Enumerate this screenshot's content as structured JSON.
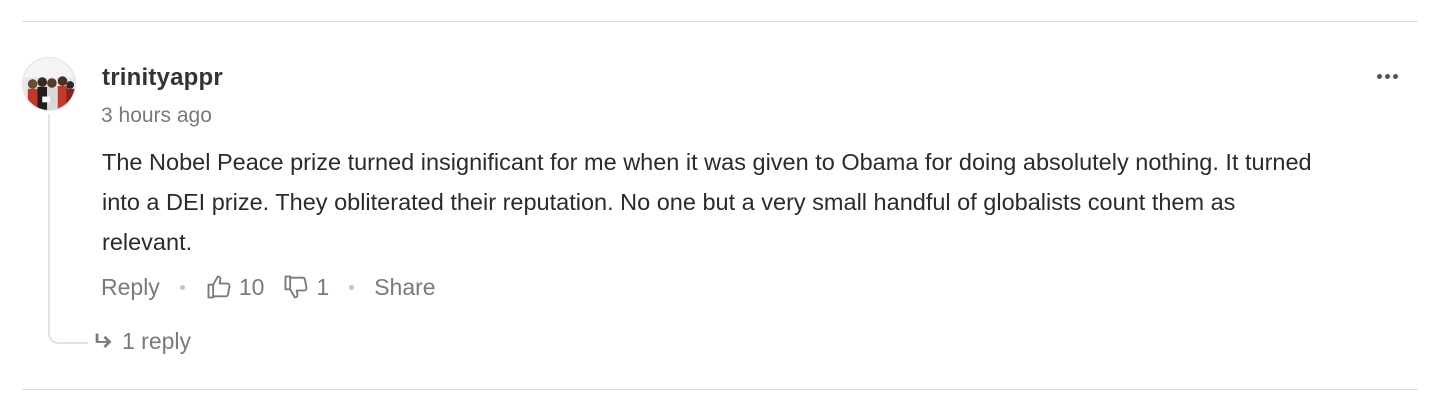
{
  "comment": {
    "username": "trinityappr",
    "timestamp": "3 hours ago",
    "body": "The Nobel Peace prize turned insignificant for me when it was given to Obama for doing absolutely nothing. It turned into a DEI prize. They obliterated their reputation. No one but a very small handful of globalists count them as relevant.",
    "avatar_icon": "group-photo-avatar",
    "more_icon": "more-dots-icon"
  },
  "actions": {
    "reply_label": "Reply",
    "like_count": "10",
    "dislike_count": "1",
    "share_label": "Share"
  },
  "replies": {
    "label": "1 reply"
  }
}
